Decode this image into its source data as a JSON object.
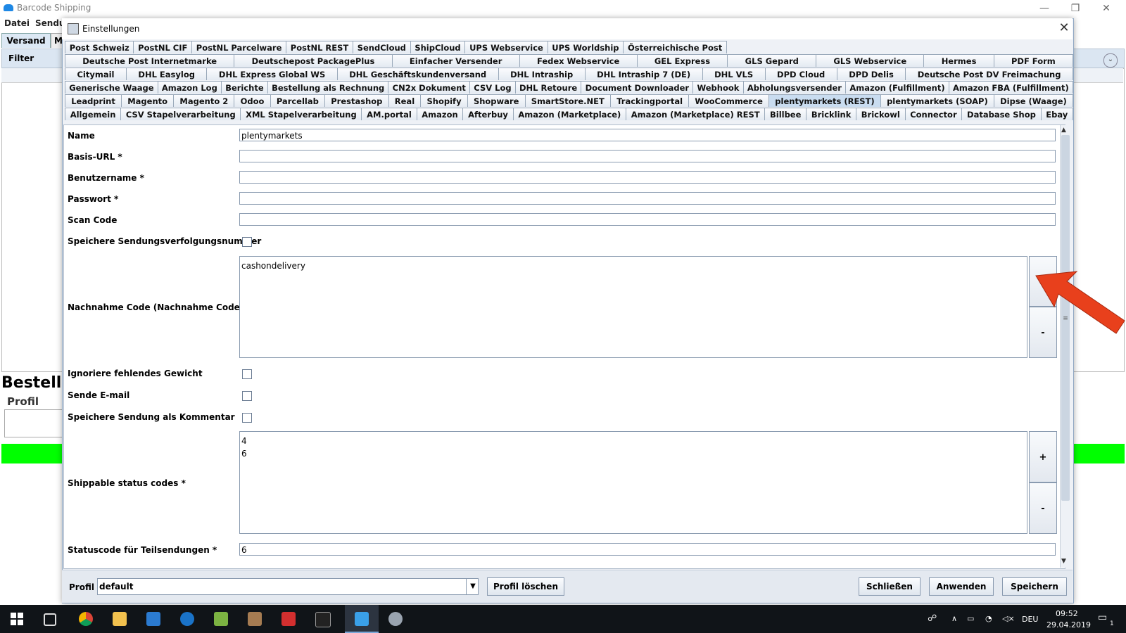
{
  "app": {
    "title": "Barcode Shipping",
    "menu": [
      "Datei",
      "Sendu"
    ],
    "tabs": [
      "Versand",
      "M"
    ],
    "filter_label": "Filter",
    "bestellung": "Bestellu",
    "profil": "Profil",
    "window_controls": [
      "—",
      "❐",
      "✕"
    ]
  },
  "dialog": {
    "title": "Einstellungen",
    "close": "✕",
    "tab_rows": [
      [
        "Post Schweiz",
        "PostNL CIF",
        "PostNL Parcelware",
        "PostNL REST",
        "SendCloud",
        "ShipCloud",
        "UPS Webservice",
        "UPS Worldship",
        "Österreichische Post"
      ],
      [
        "Deutsche Post Internetmarke",
        "Deutschepost PackagePlus",
        "Einfacher Versender",
        "Fedex Webservice",
        "GEL Express",
        "GLS Gepard",
        "GLS Webservice",
        "Hermes",
        "PDF Form"
      ],
      [
        "Citymail",
        "DHL Easylog",
        "DHL Express Global WS",
        "DHL Geschäftskundenversand",
        "DHL Intraship",
        "DHL Intraship 7 (DE)",
        "DHL VLS",
        "DPD Cloud",
        "DPD Delis",
        "Deutsche Post DV Freimachung"
      ],
      [
        "Generische Waage",
        "Amazon Log",
        "Berichte",
        "Bestellung als Rechnung",
        "CN2x Dokument",
        "CSV Log",
        "DHL Retoure",
        "Document Downloader",
        "Webhook",
        "Abholungsversender",
        "Amazon (Fulfillment)",
        "Amazon FBA (Fulfillment)"
      ],
      [
        "Leadprint",
        "Magento",
        "Magento 2",
        "Odoo",
        "Parcellab",
        "Prestashop",
        "Real",
        "Shopify",
        "Shopware",
        "SmartStore.NET",
        "Trackingportal",
        "WooCommerce",
        "plentymarkets (REST)",
        "plentymarkets (SOAP)",
        "Dipse (Waage)"
      ],
      [
        "Allgemein",
        "CSV Stapelverarbeitung",
        "XML Stapelverarbeitung",
        "AM.portal",
        "Amazon",
        "Afterbuy",
        "Amazon (Marketplace)",
        "Amazon (Marketplace) REST",
        "Billbee",
        "Bricklink",
        "Brickowl",
        "Connector",
        "Database Shop",
        "Ebay"
      ]
    ],
    "selected_tab": "plentymarkets (REST)",
    "form": {
      "name_label": "Name",
      "name_value": "plentymarkets",
      "baseurl_label": "Basis-URL *",
      "baseurl_value": "",
      "user_label": "Benutzername *",
      "user_value": "",
      "password_label": "Passwort *",
      "password_value": "",
      "scancode_label": "Scan Code",
      "scancode_value": "",
      "save_tracking_label": "Speichere Sendungsverfolgungsnummer",
      "save_tracking_checked": false,
      "cod_label": "Nachnahme Code (Nachnahme Code)",
      "cod_values": [
        "cashondelivery"
      ],
      "ignore_weight_label": "Ignoriere fehlendes Gewicht",
      "ignore_weight_checked": false,
      "send_email_label": "Sende E-mail",
      "send_email_checked": false,
      "save_comment_label": "Speichere Sendung als Kommentar",
      "save_comment_checked": false,
      "status_codes_label": "Shippable status codes *",
      "status_codes_values": [
        "4",
        "6"
      ],
      "partial_label": "Statuscode für Teilsendungen *",
      "partial_value": "6",
      "add_label": "+",
      "remove_label": "-"
    },
    "footer": {
      "profil_label": "Profil",
      "profil_value": "default",
      "delete_profile": "Profil löschen",
      "close": "Schließen",
      "apply": "Anwenden",
      "save": "Speichern"
    }
  },
  "taskbar": {
    "lang": "DEU",
    "time": "09:52",
    "date": "29.04.2019",
    "notification_count": "1"
  },
  "colors": {
    "selected_tab": "#c9dcf0",
    "green_status": "#00ff00",
    "arrow": "#e8401c"
  }
}
